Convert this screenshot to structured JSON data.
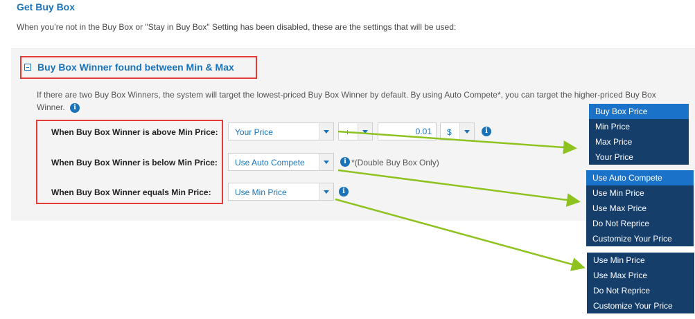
{
  "header": {
    "title": "Get Buy Box",
    "description": "When you’re not in the Buy Box or \"Stay in Buy Box\" Setting has been disabled, these are the settings that will be used:"
  },
  "section": {
    "title": "Buy Box Winner found between Min & Max",
    "info": "If there are two Buy Box Winners, the system will target the lowest-priced Buy Box Winner by default. By using Auto Compete*, you can target the higher-priced Buy Box Winner.",
    "info_icon": "i"
  },
  "rules": [
    {
      "label": "When Buy Box Winner is above Min Price:",
      "select": "Your Price",
      "operator": "+",
      "amount": "0.01",
      "unit": "$"
    },
    {
      "label": "When Buy Box Winner is below Min Price:",
      "select": "Use Auto Compete",
      "note": "*(Double Buy Box Only)"
    },
    {
      "label": "When Buy Box Winner equals Min Price:",
      "select": "Use Min Price"
    }
  ],
  "dropdowns": {
    "above": {
      "items": [
        "Buy Box Price",
        "Min Price",
        "Max Price",
        "Your Price"
      ],
      "selected": 0
    },
    "below": {
      "items": [
        "Use Auto Compete",
        "Use Min Price",
        "Use Max Price",
        "Do Not Reprice",
        "Customize Your Price"
      ],
      "selected": 0
    },
    "equals": {
      "items": [
        "Use Min Price",
        "Use Max Price",
        "Do Not Reprice",
        "Customize Your Price"
      ],
      "selected": -1
    }
  },
  "colors": {
    "accent": "#1a73b8",
    "highlight": "#e53935",
    "arrow": "#8dc21f",
    "dropdown_bg": "#163e6b"
  }
}
